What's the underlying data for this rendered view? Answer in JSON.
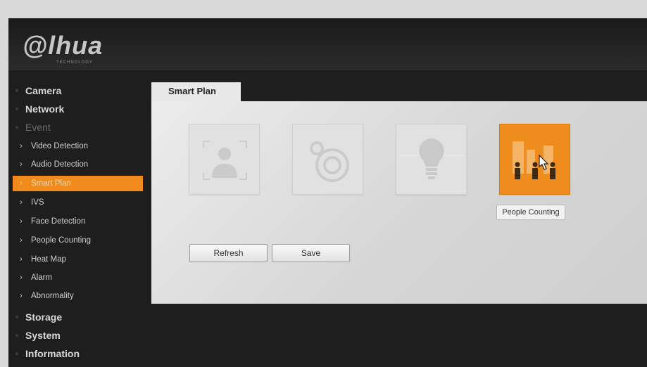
{
  "brand": {
    "logo_text": "alhua",
    "logo_sub": "TECHNOLOGY"
  },
  "sidebar": {
    "top_items": [
      {
        "label": "Camera"
      },
      {
        "label": "Network"
      },
      {
        "label": "Event"
      }
    ],
    "event_items": [
      {
        "label": "Video Detection"
      },
      {
        "label": "Audio Detection"
      },
      {
        "label": "Smart Plan",
        "active": true
      },
      {
        "label": "IVS"
      },
      {
        "label": "Face Detection"
      },
      {
        "label": "People Counting"
      },
      {
        "label": "Heat Map"
      },
      {
        "label": "Alarm"
      },
      {
        "label": "Abnormality"
      }
    ],
    "bottom_items": [
      {
        "label": "Storage"
      },
      {
        "label": "System"
      },
      {
        "label": "Information"
      }
    ]
  },
  "main": {
    "tab_label": "Smart Plan",
    "tiles": [
      {
        "icon": "face-detection-icon",
        "state": "disabled"
      },
      {
        "icon": "target-icon",
        "state": "disabled"
      },
      {
        "icon": "lightbulb-icon",
        "state": "disabled"
      },
      {
        "icon": "people-counting-icon",
        "state": "selected"
      }
    ],
    "tooltip": "People Counting",
    "buttons": {
      "refresh": "Refresh",
      "save": "Save"
    }
  },
  "colors": {
    "accent": "#f08a1c",
    "tile_active": "#ee8d1d",
    "background": "#1e1e1e"
  }
}
